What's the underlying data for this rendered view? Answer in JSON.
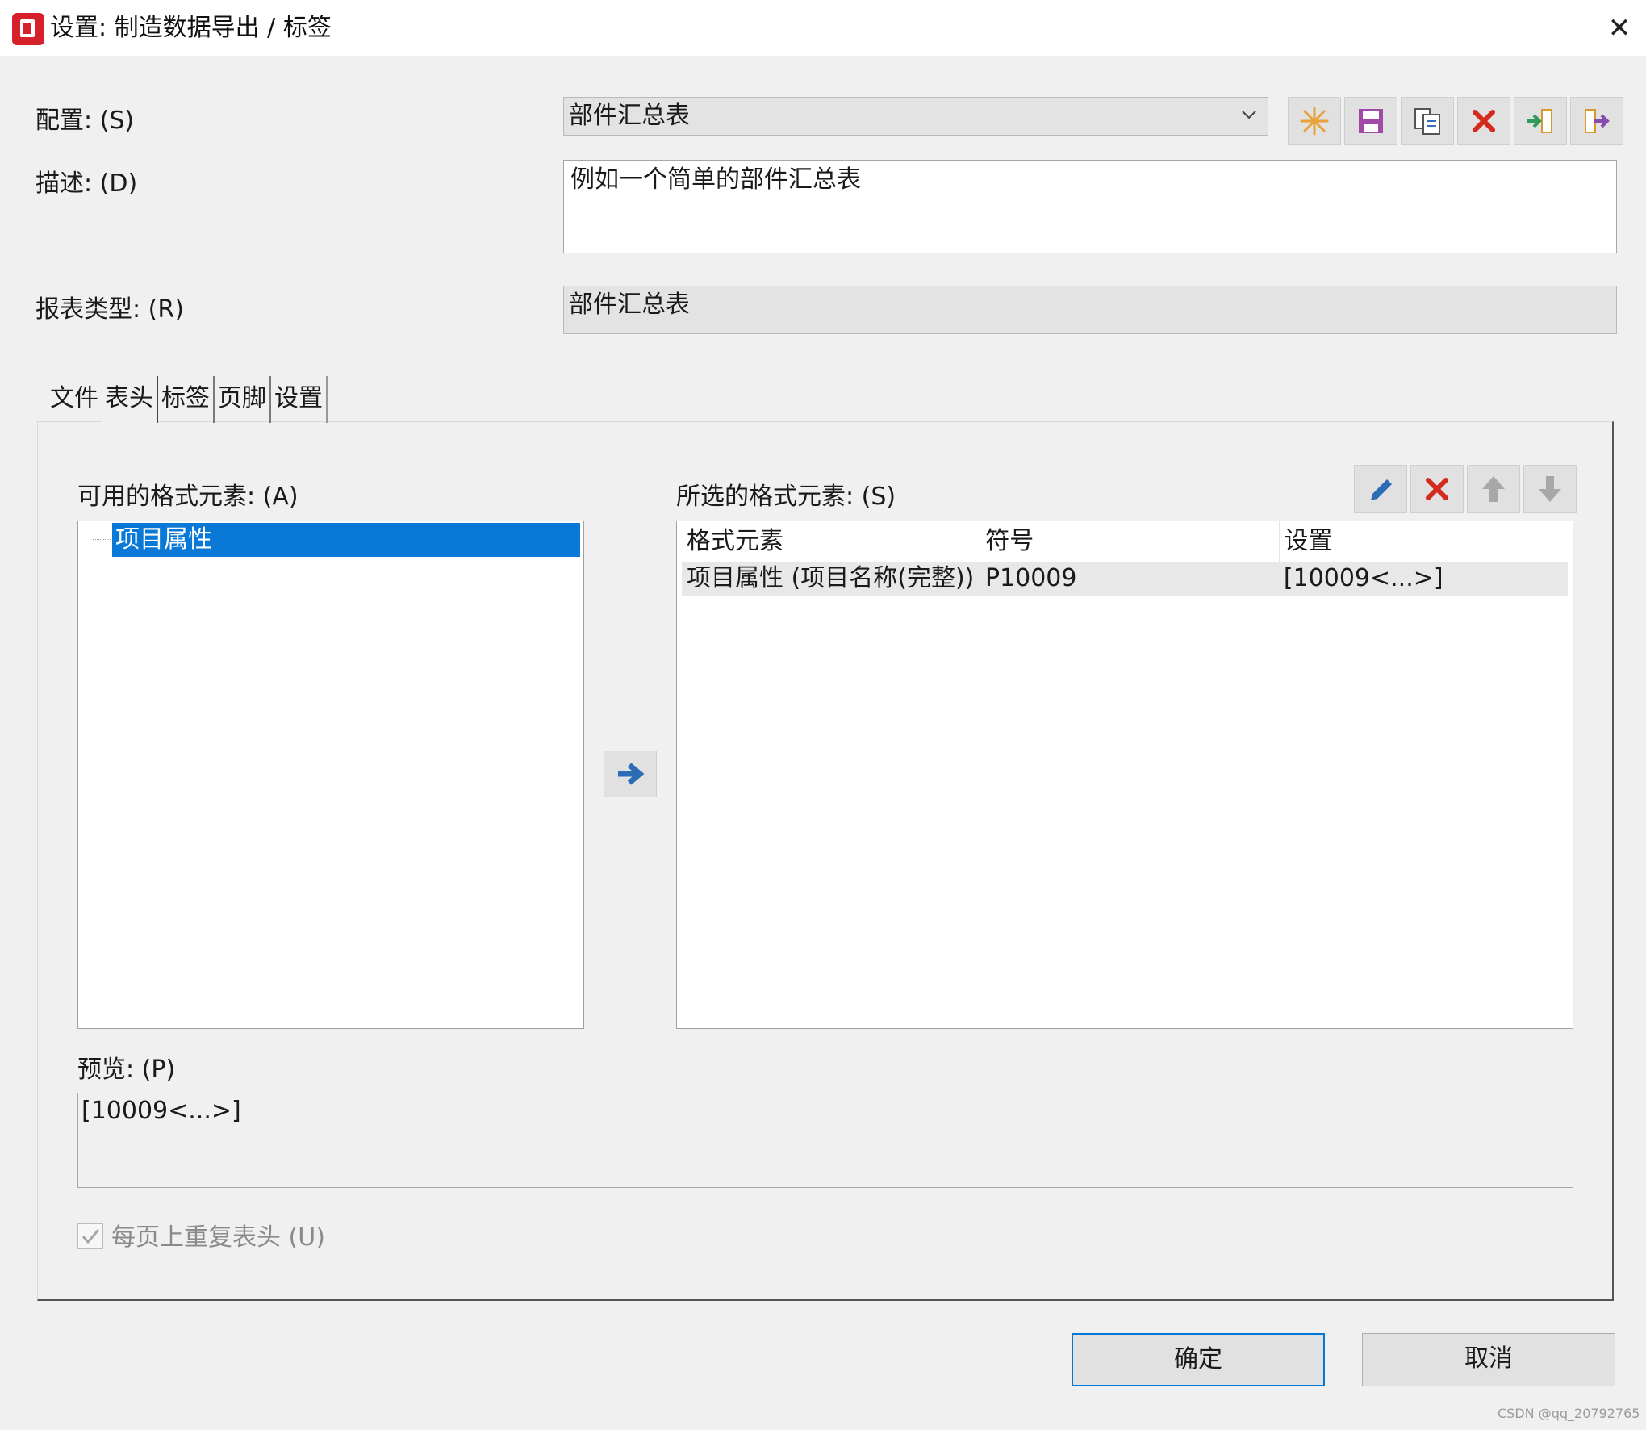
{
  "window": {
    "title": "设置: 制造数据导出 / 标签",
    "close_glyph": "✕"
  },
  "config": {
    "label": "配置: (S)",
    "value": "部件汇总表",
    "toolbar_icons": [
      "new-icon",
      "save-icon",
      "copy-icon",
      "delete-icon",
      "import-icon",
      "export-icon"
    ]
  },
  "description": {
    "label": "描述: (D)",
    "value": "例如一个简单的部件汇总表"
  },
  "report_type": {
    "label": "报表类型: (R)",
    "value": "部件汇总表"
  },
  "tabs": [
    {
      "label": "文件",
      "active": false
    },
    {
      "label": "表头",
      "active": true
    },
    {
      "label": "标签",
      "active": false
    },
    {
      "label": "页脚",
      "active": false
    },
    {
      "label": "设置",
      "active": false
    }
  ],
  "available": {
    "label": "可用的格式元素: (A)",
    "items": [
      "项目属性"
    ],
    "selected": "项目属性"
  },
  "selected_elements": {
    "label": "所选的格式元素: (S)",
    "columns": [
      "格式元素",
      "符号",
      "设置"
    ],
    "rows": [
      [
        "项目属性 (项目名称(完整))",
        "P10009",
        "[10009<...>]"
      ]
    ],
    "toolbar_icons": [
      "edit-icon",
      "delete-icon",
      "move-up-icon",
      "move-down-icon"
    ]
  },
  "preview": {
    "label": "预览: (P)",
    "value": "[10009<...>]"
  },
  "repeat_header": {
    "label": "每页上重复表头 (U)",
    "checked": true
  },
  "buttons": {
    "ok": "确定",
    "cancel": "取消"
  },
  "watermark": "CSDN @qq_20792765",
  "colors": {
    "selection": "#0a78d7",
    "delete": "#d42b1e",
    "accent_blue": "#2b6cb5",
    "app_red": "#d6202a"
  }
}
